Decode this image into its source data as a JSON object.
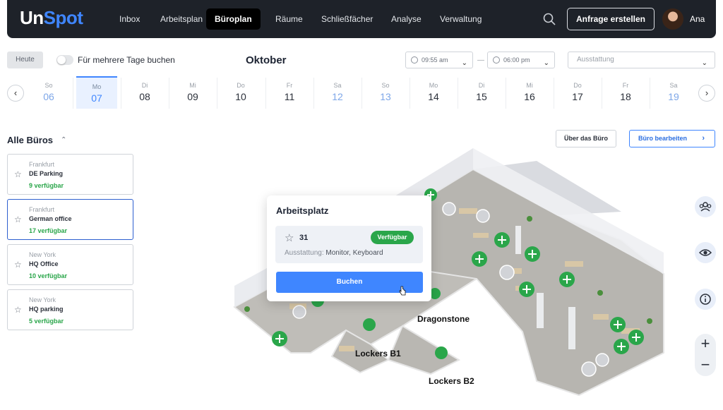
{
  "header": {
    "logo_part1": "Un",
    "logo_part2": "Spot",
    "nav": [
      "Inbox",
      "Arbeitsplan",
      "Büroplan",
      "Räume",
      "Schließfächer",
      "Analyse",
      "Verwaltung"
    ],
    "active_nav": "Büroplan",
    "request_button": "Anfrage erstellen",
    "user_name": "Ana"
  },
  "toolbar": {
    "today_button": "Heute",
    "multi_day_label": "Für mehrere Tage buchen",
    "multi_day_enabled": false,
    "month": "Oktober",
    "time_from": "09:55 am",
    "time_separator": "—",
    "time_to": "06:00 pm",
    "equipment_placeholder": "Ausstattung"
  },
  "calendar": {
    "days": [
      {
        "name": "So",
        "date": "06",
        "weekend": true
      },
      {
        "name": "Mo",
        "date": "07",
        "weekend": false,
        "selected": true
      },
      {
        "name": "Di",
        "date": "08",
        "weekend": false
      },
      {
        "name": "Mi",
        "date": "09",
        "weekend": false
      },
      {
        "name": "Do",
        "date": "10",
        "weekend": false
      },
      {
        "name": "Fr",
        "date": "11",
        "weekend": false
      },
      {
        "name": "Sa",
        "date": "12",
        "weekend": true
      },
      {
        "name": "So",
        "date": "13",
        "weekend": true
      },
      {
        "name": "Mo",
        "date": "14",
        "weekend": false
      },
      {
        "name": "Di",
        "date": "15",
        "weekend": false
      },
      {
        "name": "Mi",
        "date": "16",
        "weekend": false
      },
      {
        "name": "Do",
        "date": "17",
        "weekend": false
      },
      {
        "name": "Fr",
        "date": "18",
        "weekend": false
      },
      {
        "name": "Sa",
        "date": "19",
        "weekend": true
      }
    ]
  },
  "offices": {
    "title": "Alle Büros",
    "items": [
      {
        "city": "Frankfurt",
        "name": "DE Parking",
        "available": "9 verfügbar"
      },
      {
        "city": "Frankfurt",
        "name": "German office",
        "available": "17 verfügbar",
        "active": true
      },
      {
        "city": "New York",
        "name": "HQ Office",
        "available": "10 verfügbar"
      },
      {
        "city": "New York",
        "name": "HQ parking",
        "available": "5 verfügbar"
      }
    ]
  },
  "actions": {
    "about_office": "Über das Büro",
    "edit_office": "Büro bearbeiten"
  },
  "map": {
    "labels": {
      "dragonstone": "Dragonstone",
      "lockers_b1": "Lockers B1",
      "lockers_b2": "Lockers B2"
    }
  },
  "popup": {
    "title": "Arbeitsplatz",
    "seat_number": "31",
    "status": "Verfügbar",
    "equipment_label": "Ausstattung:",
    "equipment_value": "Monitor, Keyboard",
    "book_button": "Buchen"
  },
  "colors": {
    "brand_blue": "#3f86ff",
    "available_green": "#2aa64a",
    "topbar_bg": "#1e2229"
  }
}
